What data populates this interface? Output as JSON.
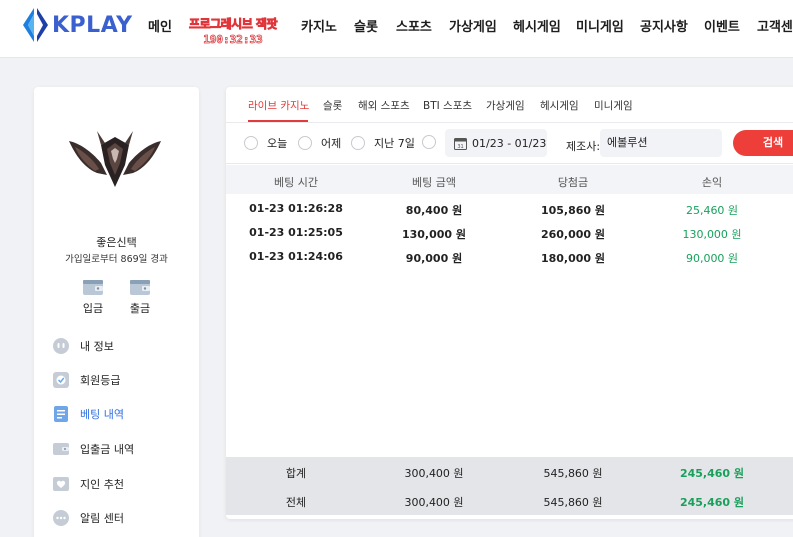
{
  "brand": {
    "logo_text": "KPLAY"
  },
  "nav": {
    "items": [
      "메인",
      "카지노",
      "슬롯",
      "스포츠",
      "가상게임",
      "헤시게임",
      "미니게임",
      "공지사항",
      "이벤트",
      "고객센터"
    ],
    "promo_title": "프로그레시브 잭팟",
    "promo_timer": "190:32:33"
  },
  "profile": {
    "username": "좋은신택",
    "joined": "가입일로부터 869일 경과",
    "deposit_label": "입금",
    "withdraw_label": "출금"
  },
  "menu": [
    {
      "label": "내 정보",
      "icon": "user-icon"
    },
    {
      "label": "회원등급",
      "icon": "grade-icon"
    },
    {
      "label": "베팅 내역",
      "icon": "betting-history-icon",
      "active": true
    },
    {
      "label": "입출금 내역",
      "icon": "transactions-icon"
    },
    {
      "label": "지인 추천",
      "icon": "referral-icon"
    },
    {
      "label": "알림 센터",
      "icon": "notification-icon"
    }
  ],
  "tabs": [
    "라이브 카지노",
    "슬롯",
    "해외 스포츠",
    "BTI 스포츠",
    "가상게임",
    "헤시게임",
    "미니게임"
  ],
  "filters": {
    "radios": [
      "오늘",
      "어제",
      "지난 7일",
      ""
    ],
    "date_range": "01/23 - 01/23",
    "maker_label": "제조사:",
    "maker_value": "에볼루션",
    "search_label": "검색"
  },
  "table": {
    "headers": [
      "베팅 시간",
      "베팅 금액",
      "당첨금",
      "손익"
    ],
    "rows": [
      [
        "01-23 01:26:28",
        "80,400 원",
        "105,860 원",
        "25,460 원"
      ],
      [
        "01-23 01:25:05",
        "130,000 원",
        "260,000 원",
        "130,000 원"
      ],
      [
        "01-23 01:24:06",
        "90,000 원",
        "180,000 원",
        "90,000 원"
      ]
    ],
    "summary": [
      [
        "합계",
        "300,400 원",
        "545,860 원",
        "245,460 원"
      ],
      [
        "전체",
        "300,400 원",
        "545,860 원",
        "245,460 원"
      ]
    ]
  },
  "colors": {
    "accent": "#ee3e3a",
    "profit": "#1aa05c",
    "active_menu": "#2f6fe0",
    "brand": "#3a5fcf"
  }
}
